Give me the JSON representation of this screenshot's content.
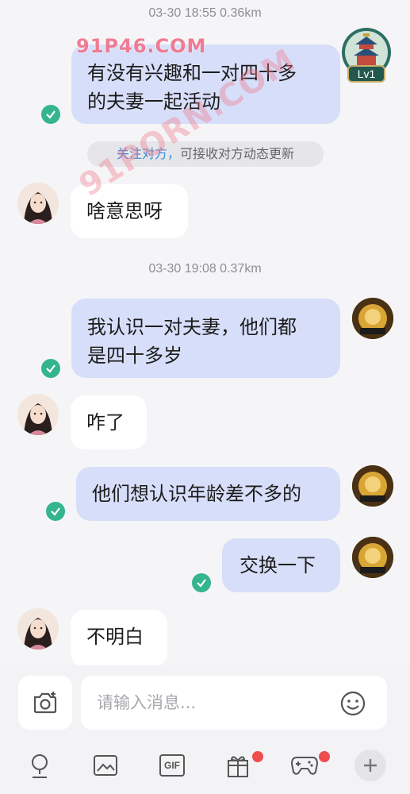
{
  "watermark": {
    "top": "91P46.COM",
    "diagonal": "91PORN.COM"
  },
  "header": {
    "level_badge": "Lv1"
  },
  "notice": {
    "link": "关注对方，",
    "text": "可接收对方动态更新"
  },
  "messages": [
    {
      "type": "timestamp",
      "text": "03-30 18:55  0.36km"
    },
    {
      "type": "out",
      "line1": "有没有兴趣和一对四十多",
      "line2": "的夫妻一起活动",
      "status": "read"
    },
    {
      "type": "in",
      "text": "啥意思呀"
    },
    {
      "type": "timestamp",
      "text": "03-30 19:08  0.37km"
    },
    {
      "type": "out",
      "line1": "我认识一对夫妻，他们都",
      "line2": "是四十多岁",
      "status": "read"
    },
    {
      "type": "in",
      "text": "咋了"
    },
    {
      "type": "out",
      "text": "他们想认识年龄差不多的",
      "status": "read"
    },
    {
      "type": "out",
      "text": "交换一下",
      "status": "read"
    },
    {
      "type": "in",
      "text": "不明白"
    }
  ],
  "composer": {
    "placeholder": "请输入消息..."
  },
  "toolbar": {
    "items": [
      "voice-icon",
      "image-icon",
      "gif-icon",
      "gift-icon",
      "game-icon",
      "plus-icon"
    ],
    "gif_label": "GIF",
    "badges": {
      "gift": true,
      "game": true
    }
  },
  "colors": {
    "outgoing_bubble": "#d7def9",
    "incoming_bubble": "#ffffff",
    "read_check": "#34b58e",
    "link": "#3a8ddb",
    "badge_dot": "#ee4d4d"
  }
}
